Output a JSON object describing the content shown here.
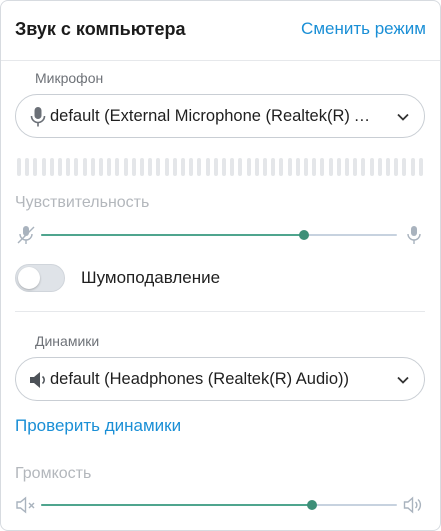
{
  "header": {
    "title": "Звук с компьютера",
    "switch_mode_label": "Сменить режим"
  },
  "microphone": {
    "section_label": "Микрофон",
    "selected_device": "default (External Microphone (Realtek(R) Audio))",
    "sensitivity_label": "Чувствительность",
    "sensitivity_level": 0.74,
    "sensitivity_enabled": false,
    "noise_suppression_label": "Шумоподавление",
    "noise_suppression_on": false
  },
  "speakers": {
    "section_label": "Динамики",
    "selected_device": "default (Headphones (Realtek(R) Audio))",
    "test_link": "Проверить динамики",
    "volume_label": "Громкость",
    "volume_level": 0.76,
    "volume_enabled": false
  },
  "colors": {
    "accent": "#1a8fd6",
    "slider_fill": "#4fa58e",
    "slider_knob": "#3d8f78",
    "track": "#c7d2df"
  },
  "icons": [
    "microphone-icon",
    "chevron-down-icon",
    "microphone-muted-icon",
    "speaker-icon",
    "speaker-muted-icon",
    "speaker-loud-icon"
  ]
}
